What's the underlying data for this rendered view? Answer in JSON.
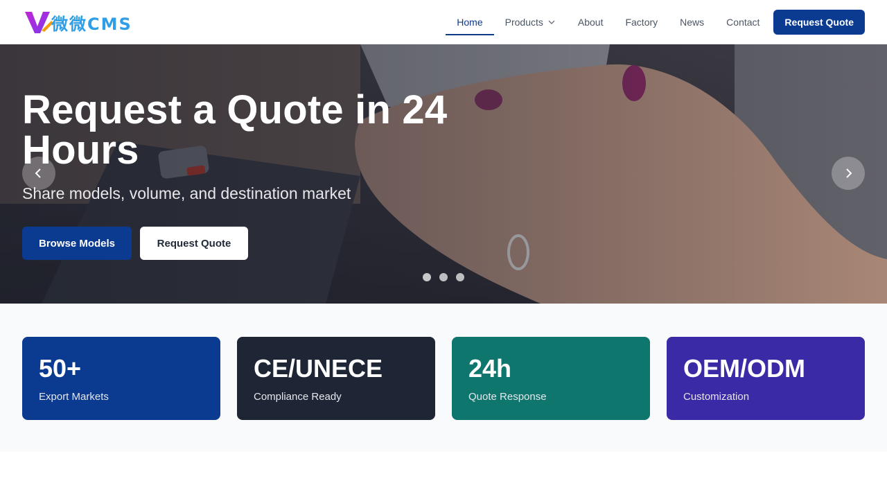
{
  "brand": {
    "logo_text": "微微CMS"
  },
  "nav": {
    "items": [
      {
        "label": "Home"
      },
      {
        "label": "Products"
      },
      {
        "label": "About"
      },
      {
        "label": "Factory"
      },
      {
        "label": "News"
      },
      {
        "label": "Contact"
      }
    ],
    "active": "Home",
    "cta_label": "Request Quote"
  },
  "hero": {
    "title": "Request a Quote in 24 Hours",
    "subtitle": "Share models, volume, and destination market",
    "primary_button": "Browse Models",
    "secondary_button": "Request Quote",
    "slides_count": 3,
    "active_slide": 1
  },
  "stats": [
    {
      "value": "50+",
      "label": "Export Markets",
      "color": "#0b3a91"
    },
    {
      "value": "CE/UNECE",
      "label": "Compliance Ready",
      "color": "#1e2535"
    },
    {
      "value": "24h",
      "label": "Quote Response",
      "color": "#0f766e"
    },
    {
      "value": "OEM/ODM",
      "label": "Customization",
      "color": "#3b2aa6"
    }
  ],
  "colors": {
    "primary": "#0b3a91",
    "nav_active": "#0e3a8a"
  },
  "icons": [
    "chevron-down-icon",
    "chevron-left-icon",
    "chevron-right-icon"
  ]
}
